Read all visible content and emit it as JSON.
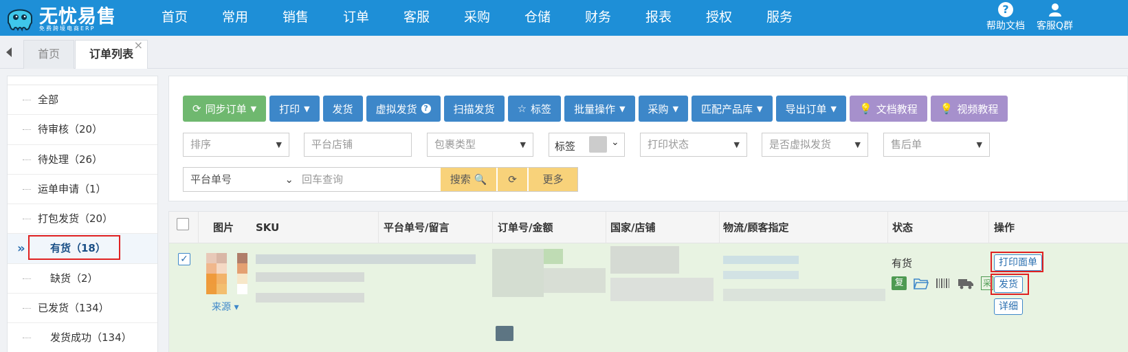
{
  "brand": {
    "title": "无忧易售",
    "subtitle": "免费跨境电商ERP"
  },
  "nav": [
    "首页",
    "常用",
    "销售",
    "订单",
    "客服",
    "采购",
    "仓储",
    "财务",
    "报表",
    "授权",
    "服务"
  ],
  "top_right": {
    "help": "帮助文档",
    "service": "客服Q群"
  },
  "tabs": {
    "home": "首页",
    "active": "订单列表",
    "close": "×"
  },
  "sidebar": {
    "items": [
      "全部",
      "待审核（20）",
      "待处理（26）",
      "运单申请（1）",
      "打包发货（20）",
      "有货（18）",
      "缺货（2）",
      "已发货（134）",
      "发货成功（134）"
    ],
    "active_marker": "»"
  },
  "toolbar": {
    "sync": "同步订单",
    "print": "打印",
    "ship": "发货",
    "virtual_ship": "虚拟发货",
    "scan_ship": "扫描发货",
    "tag": "标签",
    "batch": "批量操作",
    "purchase": "采购",
    "match": "匹配产品库",
    "export": "导出订单",
    "doc_tutorial": "文档教程",
    "video_tutorial": "视频教程"
  },
  "filters": {
    "sort": "排序",
    "platform_store": "平台店铺",
    "package_type": "包裹类型",
    "tag": "标签",
    "print_status": "打印状态",
    "virtual_ship": "是否虚拟发货",
    "after_sale": "售后单"
  },
  "search": {
    "field": "平台单号",
    "placeholder": "回车查询",
    "search": "搜索",
    "more": "更多"
  },
  "table": {
    "headers": [
      "图片",
      "SKU",
      "平台单号/留言",
      "订单号/金额",
      "国家/店铺",
      "物流/顾客指定",
      "状态",
      "操作"
    ],
    "row": {
      "status": "有货",
      "source": "来源",
      "reship": "复",
      "cai": "采",
      "actions": {
        "print_label": "打印面单",
        "ship": "发货",
        "detail": "详细"
      }
    }
  },
  "colors": {
    "topbar": "#1e8fd7",
    "row_highlight": "#e8f3e2",
    "red_box": "#e02020"
  }
}
